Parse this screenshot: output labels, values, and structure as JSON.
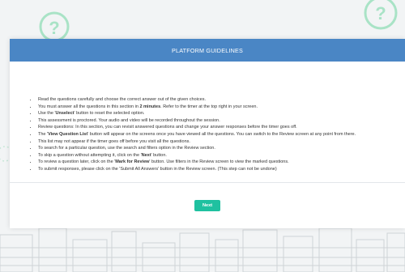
{
  "modal": {
    "title": "PLATFORM GUIDELINES",
    "rules": [
      {
        "text": "Read the questions carefully and choose the correct answer out of the given choices."
      },
      {
        "before": "You must answer all the questions in this section in ",
        "bold": "2 minutes",
        "after": ". Refer to the timer at the top right in your screen."
      },
      {
        "before": "Use the '",
        "bold": "Unselect",
        "after": "' button to reset the selected option."
      },
      {
        "text": "This assessment is proctored. Your audio and video will be recorded throughout the session."
      },
      {
        "text": "Review questions: In this section, you can revisit answered questions and change your answer responses before the timer goes off."
      },
      {
        "before": "The '",
        "bold": "View Question List",
        "after": "' button will appear on the screens once you have viewed all the questions. You can switch to the Review screen at any point from there."
      },
      {
        "text": "This list may not appear if the timer goes off before you visit all the questions."
      },
      {
        "text": "To search for a particular question, use the search and filters option in the Review section."
      },
      {
        "before": "To skip a question without attempting it, click on the '",
        "bold": "Next",
        "after": "' button."
      },
      {
        "before": "To review a question later, click on the '",
        "bold": "Mark for Review",
        "after": "' button. Use filters in the Review screen to view the marked questions."
      },
      {
        "text": "To submit responses, please click on the 'Submit All Answers' button in the Review screen. (This step can not be undone)"
      }
    ],
    "next_label": "Next"
  },
  "colors": {
    "header": "#4a86c5",
    "button": "#1fc1a0",
    "background": "#f2f4f5",
    "decoration": "#9fe0c2"
  },
  "background": {
    "icons": [
      "question-circle-icon",
      "city-skyline-illustration"
    ],
    "icon_glyph": "?"
  }
}
